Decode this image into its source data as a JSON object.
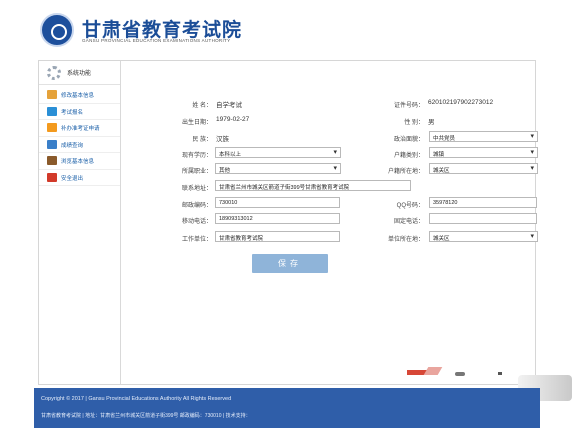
{
  "header": {
    "title": "甘肃省教育考试院",
    "subtitle": "GANSU PROVINCIAL EDUCATION EXAMINATIONS AUTHORITY"
  },
  "sidebar": {
    "heading": "系统功能",
    "items": [
      {
        "label": "修改基本信息",
        "icon": "edit-icon"
      },
      {
        "label": "考试报名",
        "icon": "exam-icon"
      },
      {
        "label": "补办准考证申请",
        "icon": "bonus-icon"
      },
      {
        "label": "成绩查询",
        "icon": "query-icon"
      },
      {
        "label": "浏览基本信息",
        "icon": "book-icon"
      },
      {
        "label": "安全退出",
        "icon": "exit-icon"
      }
    ]
  },
  "form": {
    "name_label": "姓 名：",
    "name_value": "自学考试",
    "id_label": "证件号码：",
    "id_value": "620102197902273012",
    "birth_label": "出生日期：",
    "birth_value": "1979-02-27",
    "gender_label": "性 别：",
    "gender_value": "男",
    "ethnic_label": "民 族：",
    "ethnic_value": "汉族",
    "political_label": "政治面貌：",
    "political_value": "中共党员",
    "education_label": "现有学历：",
    "education_value": "本科以上",
    "hukou_type_label": "户籍类别：",
    "hukou_type_value": "城镇",
    "occupation_label": "所属职业：",
    "occupation_value": "其他",
    "hukou_loc_label": "户籍所在地：",
    "hukou_loc_value": "城关区",
    "address_label": "联系地址：",
    "address_value": "甘肃省兰州市城关区箭道子街399号甘肃省教育考试院",
    "postcode_label": "邮政编码：",
    "postcode_value": "730010",
    "qq_label": "QQ号码：",
    "qq_value": "35978120",
    "mobile_label": "移动电话：",
    "mobile_value": "18909313012",
    "phone_label": "固定电话：",
    "phone_value": "",
    "employer_label": "工作单位：",
    "employer_value": "甘肃省教育考试院",
    "employer_loc_label": "单位所在地：",
    "employer_loc_value": "城关区",
    "save_label": "保存"
  },
  "footer": {
    "copyright": "Copyright © 2017 | Gansu Provincial Educations Authority All Rights Reserved",
    "info": "甘肃省教育考试院 | 地址：甘肃省兰州市城关区箭道子街399号 邮政编码：730010 | 技术支持："
  }
}
